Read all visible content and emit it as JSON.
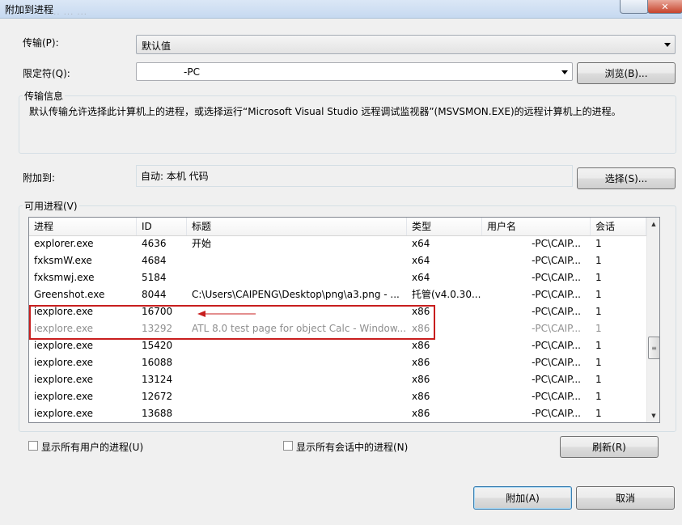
{
  "window": {
    "title": "附加到进程",
    "ghost_text": "...  ...  ..."
  },
  "transport": {
    "label": "传输(P):",
    "value": "默认值"
  },
  "qualifier": {
    "label": "限定符(Q):",
    "value": "-PC",
    "browse_label": "浏览(B)..."
  },
  "transport_info": {
    "title": "传输信息",
    "text": "默认传输允许选择此计算机上的进程，或选择运行“Microsoft Visual Studio 远程调试监视器”(MSVSMON.EXE)的远程计算机上的进程。"
  },
  "attach_to": {
    "label": "附加到:",
    "value": "自动: 本机 代码",
    "select_label": "选择(S)..."
  },
  "available_processes": {
    "title": "可用进程(V)",
    "columns": [
      "进程",
      "ID",
      "标题",
      "类型",
      "用户名",
      "会话"
    ],
    "rows": [
      {
        "process": "explorer.exe",
        "id": "4636",
        "title": "开始",
        "type": "x64",
        "user": "-PC\\CAIP...",
        "session": "1",
        "enabled": true
      },
      {
        "process": "fxksmW.exe",
        "id": "4684",
        "title": "",
        "type": "x64",
        "user": "-PC\\CAIP...",
        "session": "1",
        "enabled": true
      },
      {
        "process": "fxksmwj.exe",
        "id": "5184",
        "title": "",
        "type": "x64",
        "user": "-PC\\CAIP...",
        "session": "1",
        "enabled": true
      },
      {
        "process": "Greenshot.exe",
        "id": "8044",
        "title": "C:\\Users\\CAIPENG\\Desktop\\png\\a3.png - ...",
        "type": "托管(v4.0.30...",
        "user": "-PC\\CAIP...",
        "session": "1",
        "enabled": true
      },
      {
        "process": "iexplore.exe",
        "id": "16700",
        "title": "",
        "type": "x86",
        "user": "-PC\\CAIP...",
        "session": "1",
        "enabled": true
      },
      {
        "process": "iexplore.exe",
        "id": "13292",
        "title": "ATL 8.0 test page for object Calc - Window...",
        "type": "x86",
        "user": "-PC\\CAIP...",
        "session": "1",
        "enabled": false
      },
      {
        "process": "iexplore.exe",
        "id": "15420",
        "title": "",
        "type": "x86",
        "user": "-PC\\CAIP...",
        "session": "1",
        "enabled": true
      },
      {
        "process": "iexplore.exe",
        "id": "16088",
        "title": "",
        "type": "x86",
        "user": "-PC\\CAIP...",
        "session": "1",
        "enabled": true
      },
      {
        "process": "iexplore.exe",
        "id": "13124",
        "title": "",
        "type": "x86",
        "user": "-PC\\CAIP...",
        "session": "1",
        "enabled": true
      },
      {
        "process": "iexplore.exe",
        "id": "12672",
        "title": "",
        "type": "x86",
        "user": "-PC\\CAIP...",
        "session": "1",
        "enabled": true
      },
      {
        "process": "iexplore.exe",
        "id": "13688",
        "title": "",
        "type": "x86",
        "user": "-PC\\CAIP...",
        "session": "1",
        "enabled": true
      }
    ],
    "annotation_color": "#c81e1e"
  },
  "options": {
    "show_all_users": "显示所有用户的进程(U)",
    "show_all_sessions": "显示所有会话中的进程(N)",
    "refresh_label": "刷新(R)"
  },
  "footer": {
    "attach_label": "附加(A)",
    "cancel_label": "取消"
  },
  "icons": {
    "close": "close-icon",
    "help": "help-icon",
    "dropdown": "chevron-down-icon"
  }
}
